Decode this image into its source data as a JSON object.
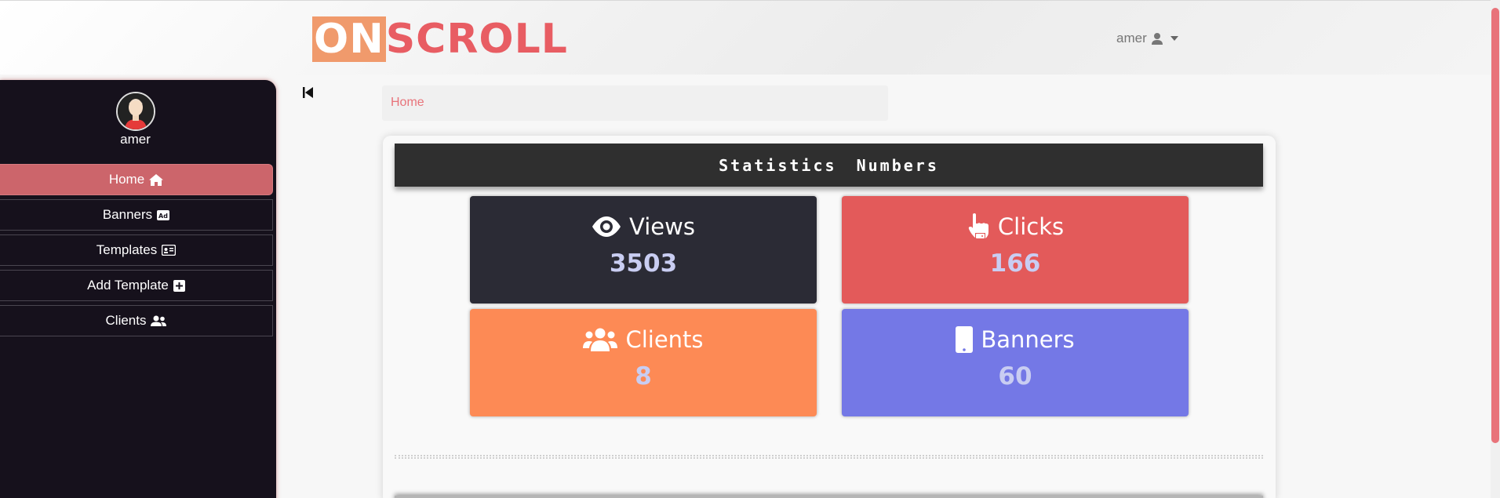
{
  "header": {
    "logo_on": "ON",
    "logo_scroll": "SCROLL",
    "username": "amer"
  },
  "sidebar": {
    "username": "amer",
    "items": [
      {
        "label": "Home",
        "icon": "home-icon",
        "active": true
      },
      {
        "label": "Banners",
        "icon": "ad-icon",
        "active": false
      },
      {
        "label": "Templates",
        "icon": "id-card-icon",
        "active": false
      },
      {
        "label": "Add Template",
        "icon": "plus-square-icon",
        "active": false
      },
      {
        "label": "Clients",
        "icon": "users-icon",
        "active": false
      }
    ]
  },
  "breadcrumb": {
    "home": "Home"
  },
  "stats": {
    "title": "Statistics Numbers",
    "cards": [
      {
        "label": "Views",
        "value": "3503",
        "icon": "eye-icon",
        "color": "#2b2b35"
      },
      {
        "label": "Clicks",
        "value": "166",
        "icon": "pointer-hand-icon",
        "color": "#e35a5a"
      },
      {
        "label": "Clients",
        "value": "8",
        "icon": "users-icon",
        "color": "#fd8a55"
      },
      {
        "label": "Banners",
        "value": "60",
        "icon": "mobile-icon",
        "color": "#7478e6"
      }
    ]
  },
  "colors": {
    "accent": "#e8737a",
    "sidebar_bg": "#16111c",
    "active_item": "#cc656b"
  }
}
